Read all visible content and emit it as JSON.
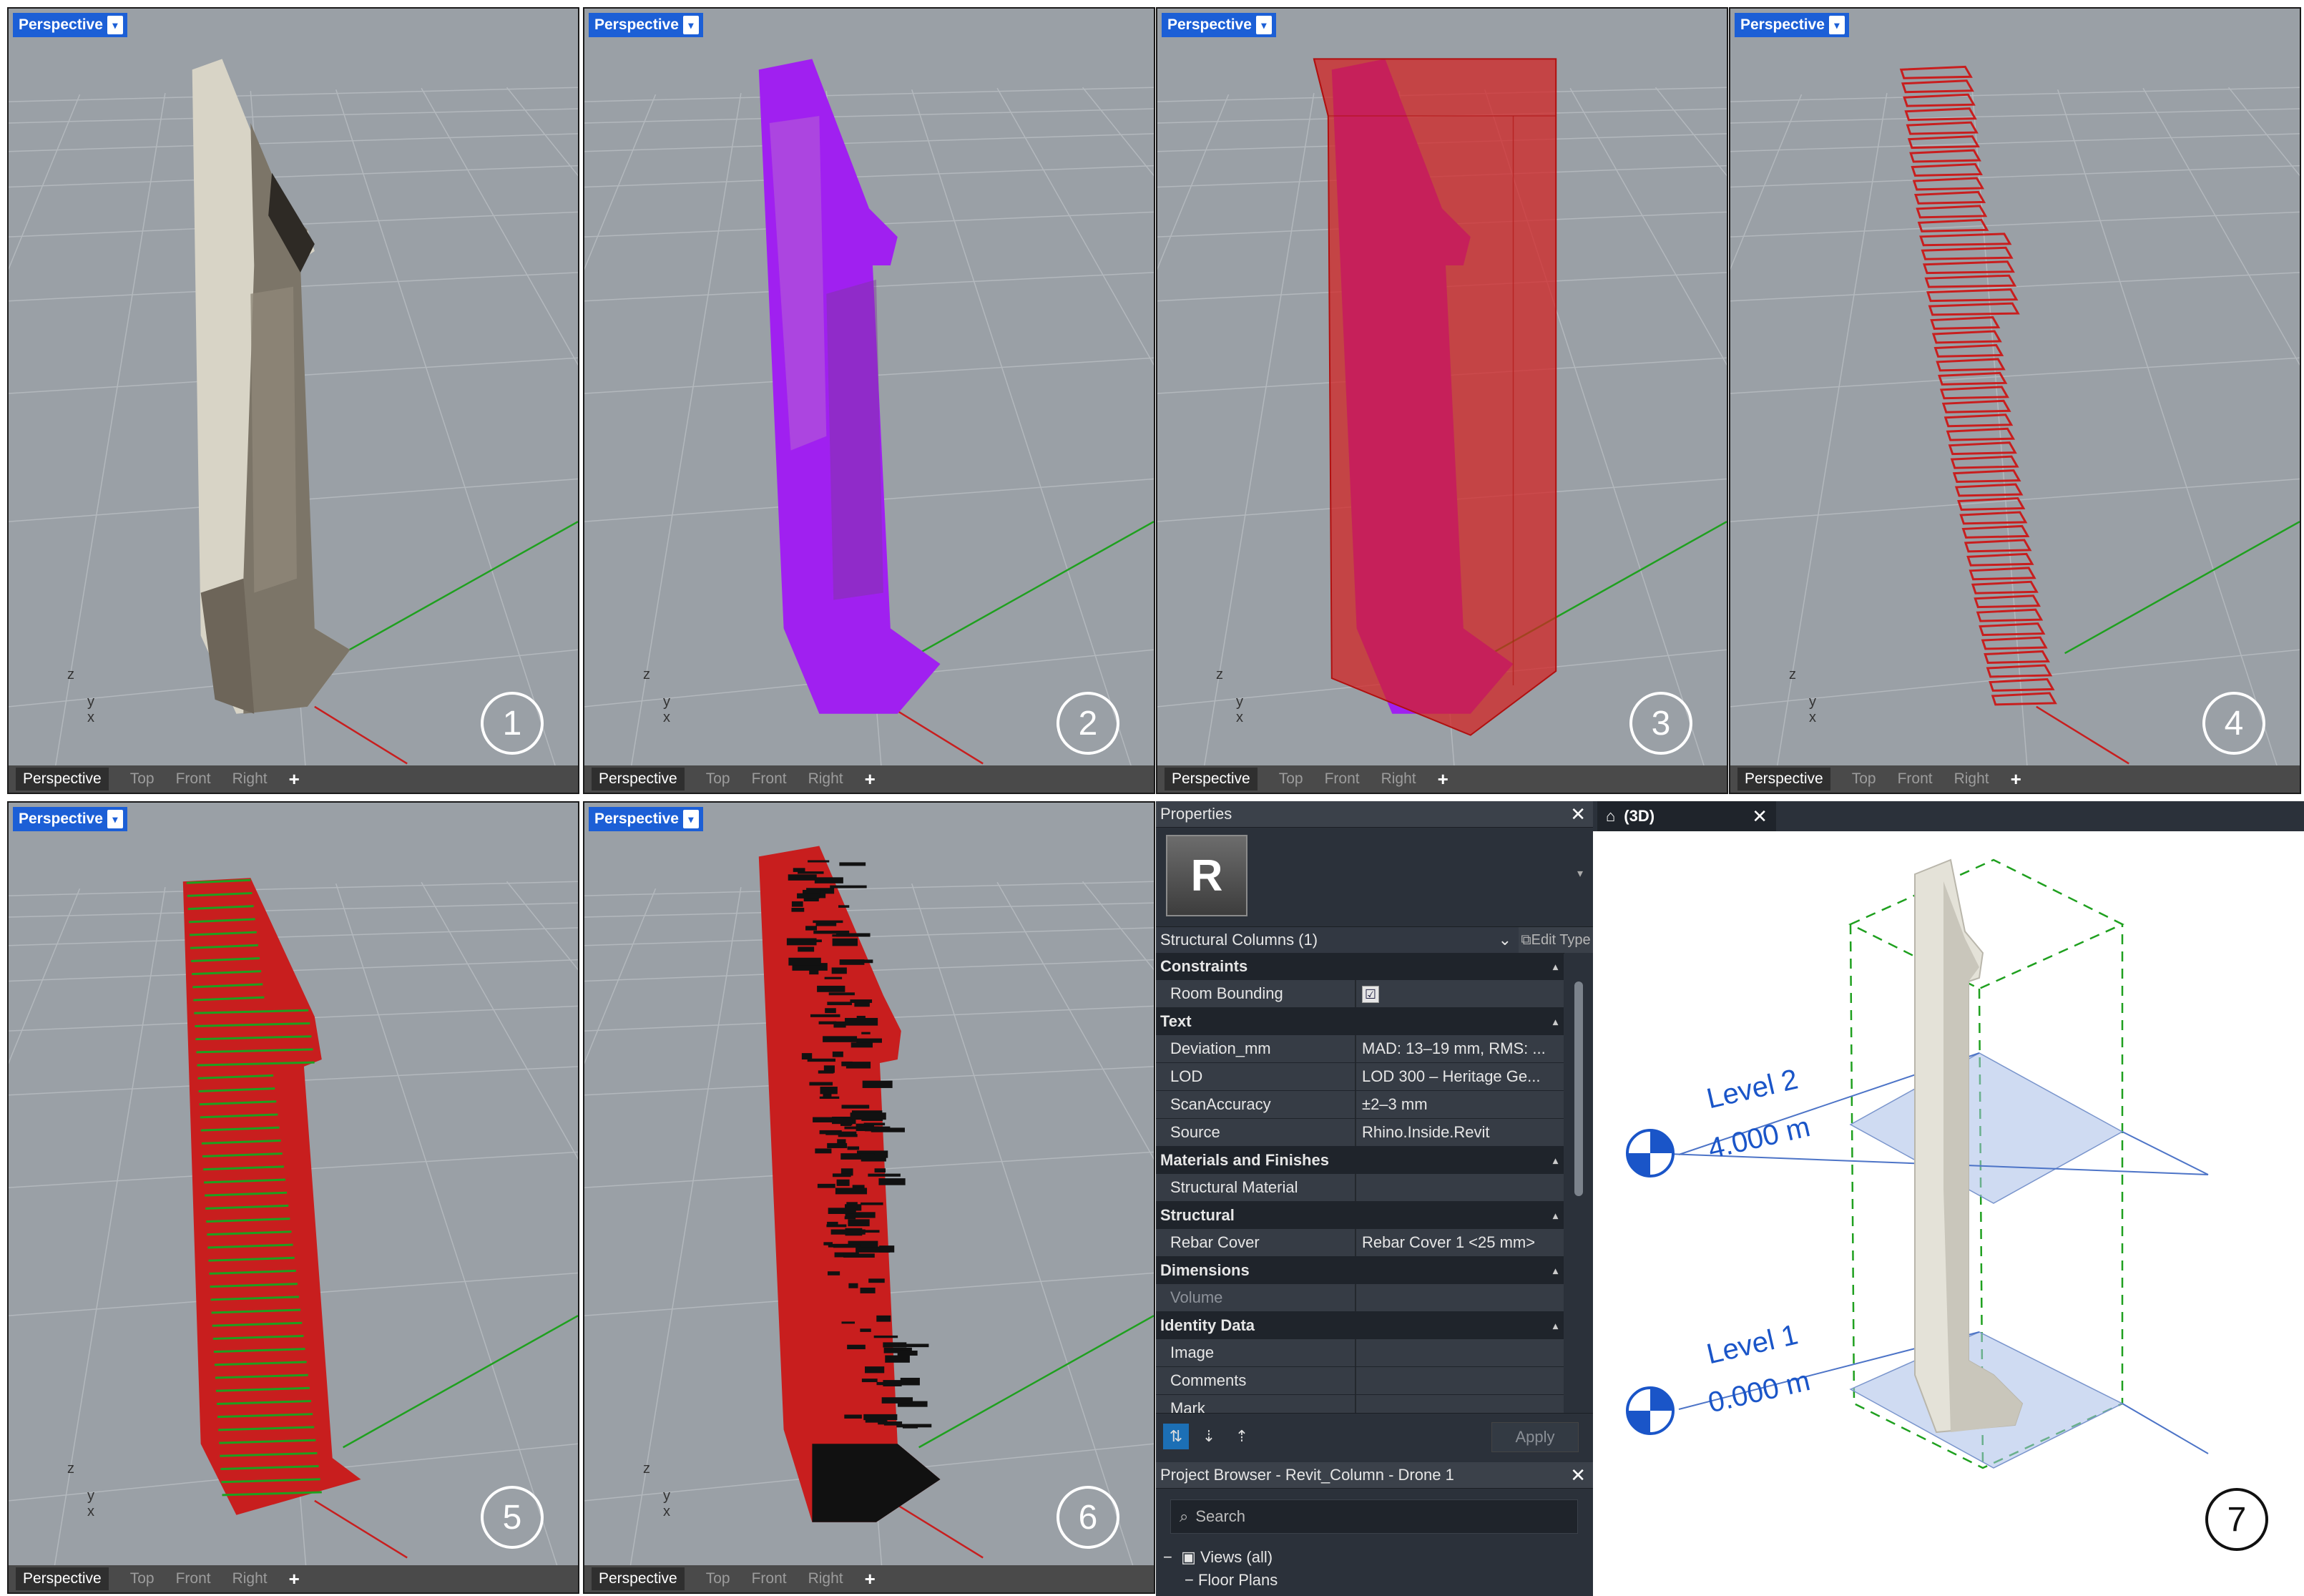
{
  "viewports": [
    {
      "label": "Perspective",
      "step": "1",
      "tabs": [
        "Perspective",
        "Top",
        "Front",
        "Right"
      ]
    },
    {
      "label": "Perspective",
      "step": "2",
      "tabs": [
        "Perspective",
        "Top",
        "Front",
        "Right"
      ]
    },
    {
      "label": "Perspective",
      "step": "3",
      "tabs": [
        "Perspective",
        "Top",
        "Front",
        "Right"
      ]
    },
    {
      "label": "Perspective",
      "step": "4",
      "tabs": [
        "Perspective",
        "Top",
        "Front",
        "Right"
      ]
    },
    {
      "label": "Perspective",
      "step": "5",
      "tabs": [
        "Perspective",
        "Top",
        "Front",
        "Right"
      ]
    },
    {
      "label": "Perspective",
      "step": "6",
      "tabs": [
        "Perspective",
        "Top",
        "Front",
        "Right"
      ]
    }
  ],
  "axes": {
    "z": "z",
    "y": "y",
    "x": "x"
  },
  "add_tab": "+",
  "properties": {
    "title": "Properties",
    "logo_letter": "R",
    "type_selector": "Structural Columns (1)",
    "edit_type": "Edit Type",
    "sections": [
      {
        "name": "Constraints",
        "rows": [
          {
            "name": "Room Bounding",
            "value": "",
            "check": "☑"
          }
        ]
      },
      {
        "name": "Text",
        "rows": [
          {
            "name": "Deviation_mm",
            "value": "MAD: 13–19 mm, RMS: ..."
          },
          {
            "name": "LOD",
            "value": "LOD 300 – Heritage Ge..."
          },
          {
            "name": "ScanAccuracy",
            "value": "±2–3 mm"
          },
          {
            "name": "Source",
            "value": "Rhino.Inside.Revit"
          }
        ]
      },
      {
        "name": "Materials and Finishes",
        "rows": [
          {
            "name": "Structural Material",
            "value": ""
          }
        ]
      },
      {
        "name": "Structural",
        "rows": [
          {
            "name": "Rebar Cover",
            "value": "Rebar Cover 1 <25 mm>"
          }
        ]
      },
      {
        "name": "Dimensions",
        "rows": [
          {
            "name": "Volume",
            "value": ""
          }
        ]
      },
      {
        "name": "Identity Data",
        "rows": [
          {
            "name": "Image",
            "value": ""
          },
          {
            "name": "Comments",
            "value": ""
          },
          {
            "name": "Mark",
            "value": ""
          }
        ]
      }
    ],
    "apply": "Apply"
  },
  "project_browser": {
    "title": "Project Browser - Revit_Column - Drone 1",
    "search_placeholder": "Search",
    "views": "Views (all)",
    "floor_plans": "Floor Plans"
  },
  "view3d": {
    "tab": "(3D)",
    "level2_name": "Level 2",
    "level2_elev": "4.000 m",
    "level1_name": "Level 1",
    "level1_elev": "0.000 m",
    "step": "7"
  },
  "colors": {
    "viewport_bg": "#9aa0a6",
    "viewport_label": "#1c5fd6",
    "mesh_purple": "#a020f0",
    "bbox_red": "#d42020",
    "contour_red": "#c81e1e",
    "green_lines": "#1fa01f",
    "level_blue": "#1a55c8"
  }
}
